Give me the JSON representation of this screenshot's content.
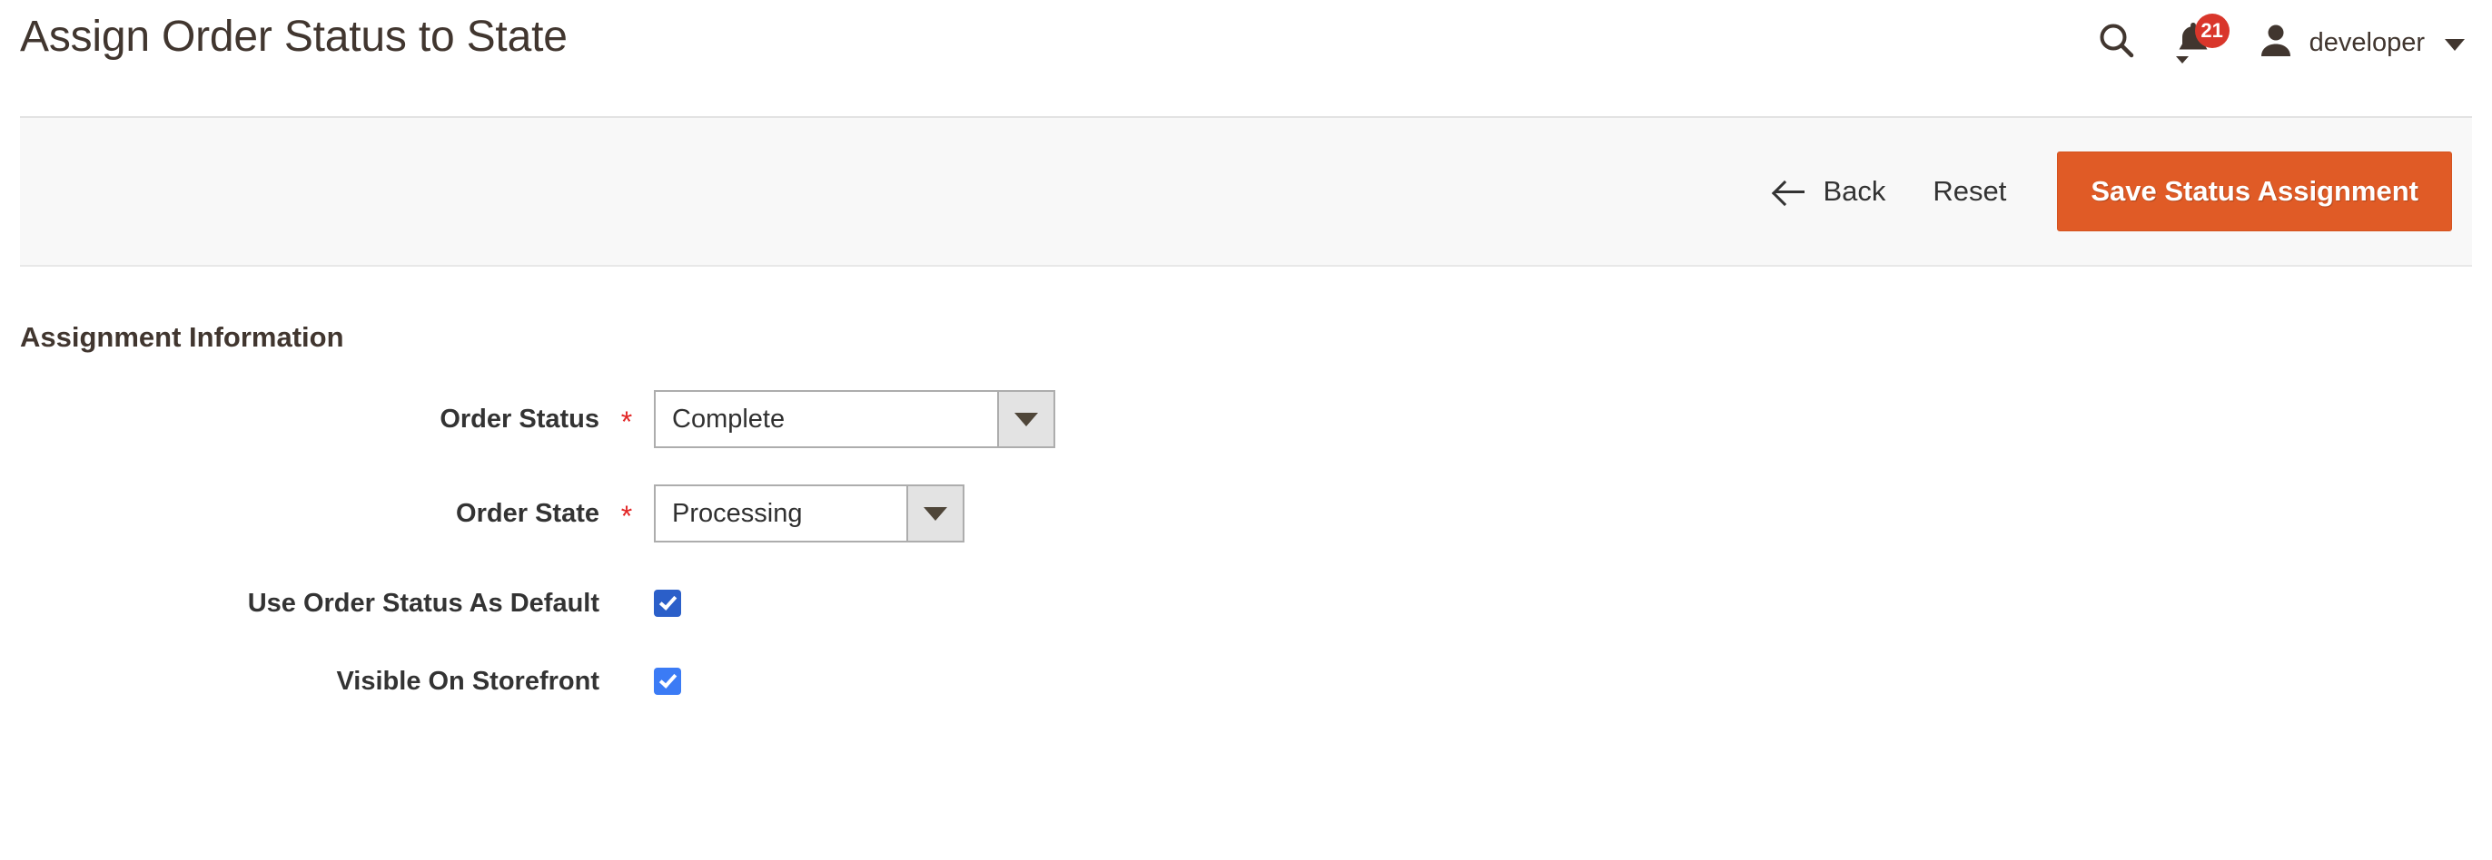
{
  "header": {
    "title": "Assign Order Status to State",
    "search_icon": "search-icon",
    "notifications": {
      "icon": "bell-icon",
      "count": "21",
      "badge_color": "#d9362b"
    },
    "user": {
      "avatar_icon": "user-icon",
      "name": "developer",
      "caret_icon": "chevron-down-icon"
    }
  },
  "action_bar": {
    "back": {
      "label": "Back",
      "icon": "arrow-left-icon"
    },
    "reset": {
      "label": "Reset"
    },
    "save": {
      "label": "Save Status Assignment",
      "color": "#e05b26"
    }
  },
  "main": {
    "section_title": "Assignment Information",
    "required_marker": "*",
    "fields": [
      {
        "label": "Order Status",
        "required": true,
        "type": "select",
        "value": "Complete"
      },
      {
        "label": "Order State",
        "required": true,
        "type": "select",
        "value": "Processing"
      },
      {
        "label": "Use Order Status As Default",
        "required": false,
        "type": "checkbox",
        "checked": true,
        "color": "#2b5fc9"
      },
      {
        "label": "Visible On Storefront",
        "required": false,
        "type": "checkbox",
        "checked": true,
        "color": "#3b7bf5"
      }
    ]
  }
}
